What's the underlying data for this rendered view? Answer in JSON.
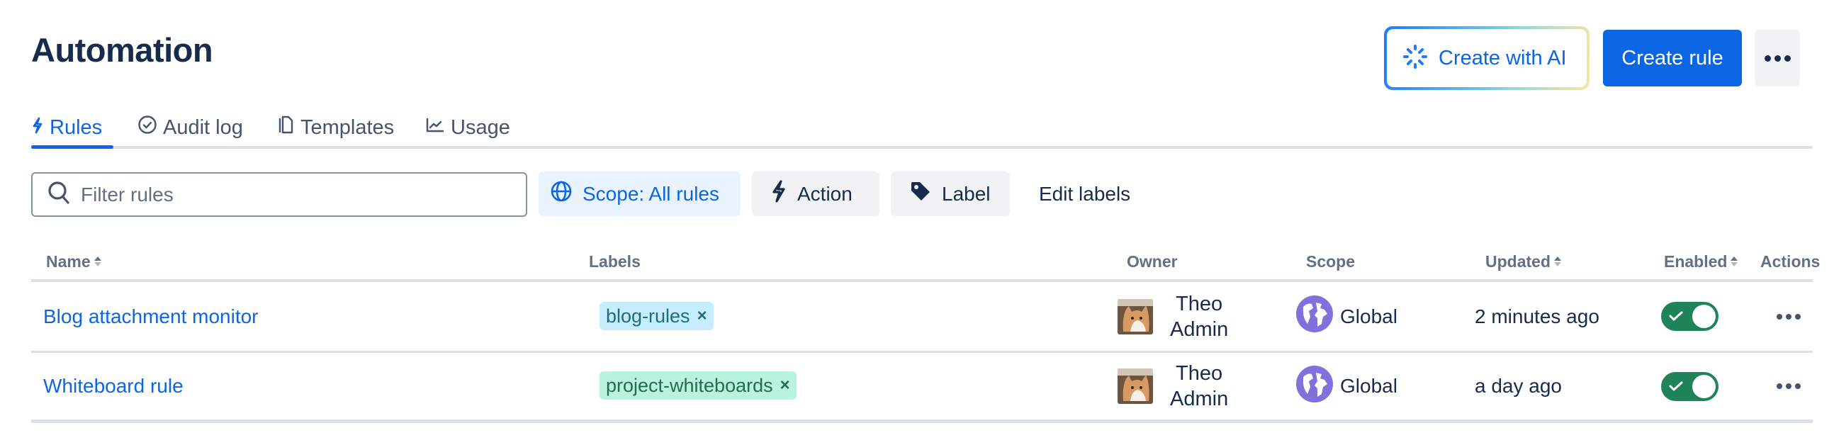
{
  "page": {
    "title": "Automation"
  },
  "header": {
    "create_ai_label": "Create with AI",
    "create_rule_label": "Create rule",
    "more_icon": "more-horizontal-icon"
  },
  "tabs": [
    {
      "label": "Rules",
      "icon": "lightning-icon",
      "active": true
    },
    {
      "label": "Audit log",
      "icon": "check-circle-icon",
      "active": false
    },
    {
      "label": "Templates",
      "icon": "copy-icon",
      "active": false
    },
    {
      "label": "Usage",
      "icon": "chart-line-icon",
      "active": false
    }
  ],
  "filters": {
    "search_placeholder": "Filter rules",
    "search_value": "",
    "scope_label": "Scope: All rules",
    "action_label": "Action",
    "label_label": "Label",
    "edit_labels": "Edit labels"
  },
  "table": {
    "columns": [
      {
        "label": "Name",
        "sortable": true
      },
      {
        "label": "Labels",
        "sortable": false
      },
      {
        "label": "Owner",
        "sortable": false
      },
      {
        "label": "Scope",
        "sortable": false
      },
      {
        "label": "Updated",
        "sortable": true
      },
      {
        "label": "Enabled",
        "sortable": true
      },
      {
        "label": "Actions",
        "sortable": false
      }
    ],
    "rows": [
      {
        "name": "Blog attachment monitor",
        "label": "blog-rules",
        "label_color": "#c6edfb",
        "label_text_color": "#206a83",
        "owner_first": "Theo",
        "owner_last": "Admin",
        "scope": "Global",
        "updated": "2 minutes ago",
        "enabled": true
      },
      {
        "name": "Whiteboard rule",
        "label": "project-whiteboards",
        "label_color": "#baf3db",
        "label_text_color": "#216e4e",
        "owner_first": "Theo",
        "owner_last": "Admin",
        "scope": "Global",
        "updated": "a day ago",
        "enabled": true
      }
    ],
    "remove_label_glyph": "×"
  },
  "colors": {
    "brand": "#0c66e4",
    "text": "#172b4d",
    "subtle_text": "#626f86",
    "toggle_on": "#1f845a",
    "scope_globe": "#8270db"
  }
}
